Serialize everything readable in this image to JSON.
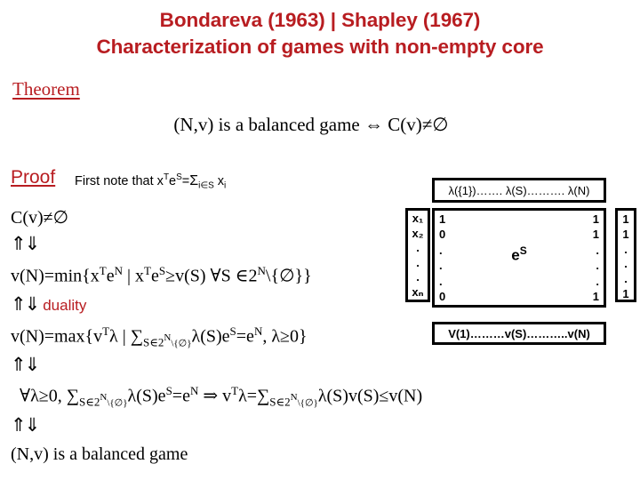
{
  "slide": {
    "background_color": "#ffffff",
    "accent_color": "#b81d21",
    "text_color": "#000000"
  },
  "title": {
    "line1": "Bondareva (1963) | Shapley (1967)",
    "line2": "Characterization of games with  non-empty core"
  },
  "theorem": {
    "label": "Theorem",
    "statement": "(N,v) is a balanced game ⇔ C(v)≠∅"
  },
  "proof": {
    "label": "Proof",
    "note_prefix": "First note that x",
    "note_sup_T": "T",
    "note_e": "e",
    "note_sup_S": "S",
    "note_eq": "=",
    "note_sigma": "Σ",
    "note_sub_ies": "i∈S",
    "note_x": "x",
    "note_sub_i": "i"
  },
  "chain": {
    "line_core": "C(v)≠∅",
    "equiv_1": "⇑⇓",
    "line_min_a": "v(N)=min{x",
    "line_min_sup1": "T",
    "line_min_b": "e",
    "line_min_sup2": "N",
    "line_min_c": " | x",
    "line_min_sup3": "T",
    "line_min_d": "e",
    "line_min_sup4": "S",
    "line_min_e": "≥v(S)  ∀S ∈2",
    "line_min_sup5": "N",
    "line_min_f": "\\{∅}}",
    "equiv_2": "⇑⇓",
    "duality_label": "duality",
    "line_max_a": "v(N)=max{v",
    "line_max_sup1": "T",
    "line_max_b": "λ | ∑",
    "line_max_sub1": "S∈2",
    "line_max_sub1_sup": "N",
    "line_max_sub2": "\\{∅}",
    "line_max_c": "λ(S)e",
    "line_max_sup2": "S",
    "line_max_d": "=e",
    "line_max_sup3": "N",
    "line_max_e": ", λ≥0}",
    "equiv_3": "⇑⇓",
    "line_forall_a": "∀λ≥0,   ∑",
    "line_forall_sub1": "S∈2",
    "line_forall_sub1_sup": "N",
    "line_forall_sub2": "\\{∅}",
    "line_forall_b": "λ(S)e",
    "line_forall_sup1": "S",
    "line_forall_c": "=e",
    "line_forall_sup2": "N",
    "line_forall_d": " ⇒ v",
    "line_forall_sup3": "T",
    "line_forall_e": "λ=∑",
    "line_forall_sub3": "S∈2",
    "line_forall_sub3_sup": "N",
    "line_forall_sub4": "\\{∅}",
    "line_forall_f": "λ(S)v(S)≤v(N)",
    "equiv_4": "⇑⇓",
    "line_final": "(N,v) is a balanced game"
  },
  "diagram": {
    "lambda_header": "λ({1})……. λ(S)………. λ(N)",
    "v_footer": "V(1)………v(S)………..v(N)",
    "x_vector": [
      "x₁",
      "x₂",
      ".",
      ".",
      ".",
      "xₙ"
    ],
    "matrix_left_column": [
      "1",
      "0",
      ".",
      ".",
      ".",
      "0"
    ],
    "matrix_right_column": [
      "1",
      "1",
      ".",
      ".",
      ".",
      "1"
    ],
    "matrix_center_base": "e",
    "matrix_center_sup": "S",
    "ones_vector": [
      "1",
      "1",
      ".",
      ".",
      ".",
      "1"
    ]
  }
}
